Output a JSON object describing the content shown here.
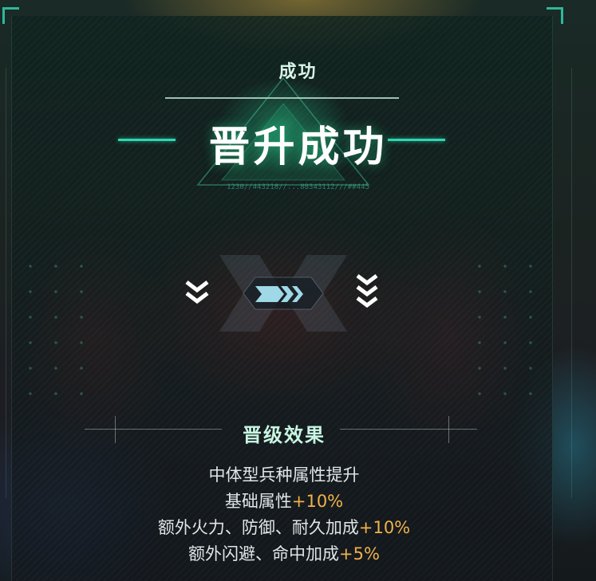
{
  "header": {
    "subtitle": "成功",
    "title": "晋升成功",
    "code_text": "1230//443218//...88343112///##445"
  },
  "rank_change": {
    "from_icon": "double-chevron-down-icon",
    "middle_icon": "triple-chevron-right-icon",
    "to_icon": "triple-chevron-down-icon",
    "accent_color": "#9fd8e6"
  },
  "effects": {
    "title": "晋级效果",
    "lines": [
      {
        "text": "中体型兵种属性提升",
        "bonus": ""
      },
      {
        "text": "基础属性",
        "bonus": "+10%"
      },
      {
        "text": "额外火力、防御、耐久加成",
        "bonus": "+10%"
      },
      {
        "text": "额外闪避、命中加成",
        "bonus": "+5%"
      }
    ]
  },
  "colors": {
    "accent": "#2fd7b0",
    "bonus": "#f1b24a",
    "text": "#dfe7e6"
  }
}
